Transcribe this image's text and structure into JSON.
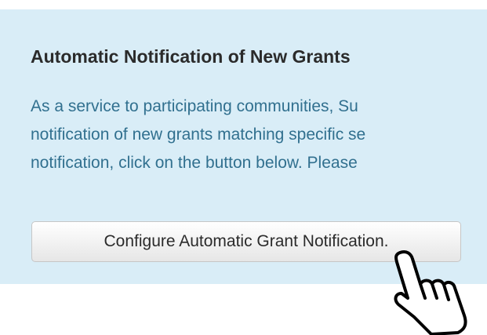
{
  "notification": {
    "heading": "Automatic Notification of New Grants",
    "lines": [
      "As a service to participating communities, Su",
      "notification of new grants matching specific se",
      "notification, click on the button below. Please"
    ],
    "button_label": "Configure Automatic Grant Notification."
  },
  "colors": {
    "panel_background": "#d9edf7",
    "body_text": "#31708f",
    "heading_text": "#2b2b2b"
  },
  "icons": {
    "cursor": "hand-pointer-icon"
  }
}
